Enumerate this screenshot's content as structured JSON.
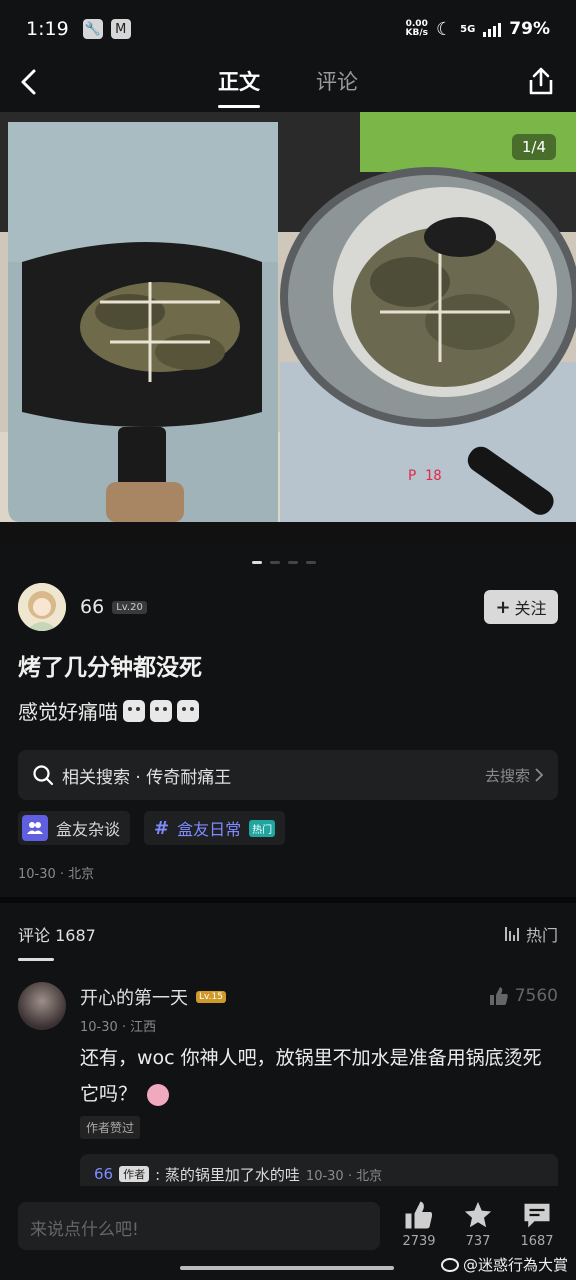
{
  "status_bar": {
    "time": "1:19",
    "net_speed_top": "0.00",
    "net_speed_bottom": "KB/s",
    "network": "5G",
    "battery": "79%"
  },
  "nav": {
    "tab_main": "正文",
    "tab_comments": "评论"
  },
  "photo": {
    "counter": "1/4"
  },
  "author": {
    "name": "66",
    "level": "Lv.20",
    "follow_label": "关注"
  },
  "post": {
    "title": "烤了几分钟都没死",
    "body": "感觉好痛喵",
    "related_search": "相关搜索 · 传奇耐痛王",
    "search_action": "去搜索",
    "tags": [
      {
        "label": "盒友杂谈"
      },
      {
        "label": "盒友日常",
        "badge": "热门"
      }
    ],
    "meta": "10-30 · 北京"
  },
  "comments": {
    "title": "评论 1687",
    "sort": "热门",
    "items": [
      {
        "name": "开心的第一天",
        "level": "Lv.15",
        "likes": "7560",
        "meta": "10-30 · 江西",
        "text": "还有，woc 你神人吧，放锅里不加水是准备用锅底烫死它吗？",
        "badge": "作者赞过",
        "reply": {
          "user": "66",
          "author_tag": "作者",
          "text": ": 蒸的锅里加了水的哇",
          "meta": "10-30 · 北京"
        }
      }
    ]
  },
  "bottom_bar": {
    "placeholder": "来说点什么吧!",
    "like_count": "2739",
    "star_count": "737",
    "comment_count": "1687",
    "watermark": "@迷惑行為大賞"
  }
}
